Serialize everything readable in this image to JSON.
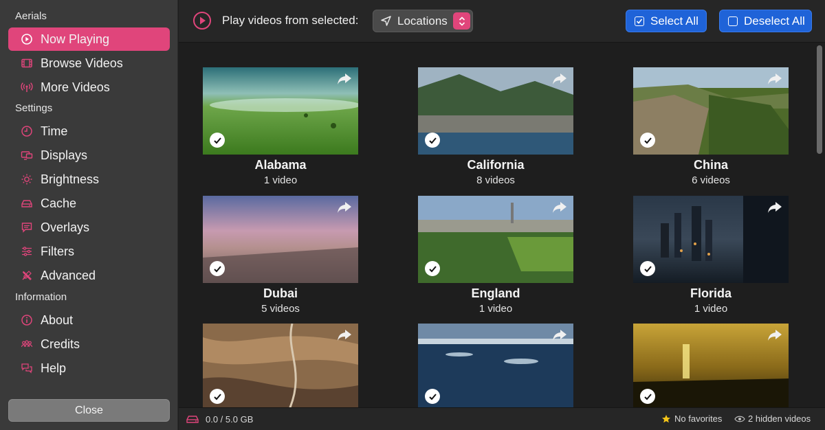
{
  "sidebar": {
    "section_aerials": "Aerials",
    "section_settings": "Settings",
    "section_information": "Information",
    "items": [
      {
        "label": "Now Playing"
      },
      {
        "label": "Browse Videos"
      },
      {
        "label": "More Videos"
      },
      {
        "label": "Time"
      },
      {
        "label": "Displays"
      },
      {
        "label": "Brightness"
      },
      {
        "label": "Cache"
      },
      {
        "label": "Overlays"
      },
      {
        "label": "Filters"
      },
      {
        "label": "Advanced"
      },
      {
        "label": "About"
      },
      {
        "label": "Credits"
      },
      {
        "label": "Help"
      }
    ],
    "close_label": "Close",
    "accent": "#e0457b"
  },
  "toolbar": {
    "play_label": "Play videos from selected:",
    "source_value": "Locations",
    "select_all_label": "Select All",
    "deselect_all_label": "Deselect All"
  },
  "locations": [
    {
      "name": "Alabama",
      "count": "1 video",
      "selected": true
    },
    {
      "name": "California",
      "count": "8 videos",
      "selected": true
    },
    {
      "name": "China",
      "count": "6 videos",
      "selected": true
    },
    {
      "name": "Dubai",
      "count": "5 videos",
      "selected": true
    },
    {
      "name": "England",
      "count": "1 video",
      "selected": true
    },
    {
      "name": "Florida",
      "count": "1 video",
      "selected": true
    },
    {
      "name": "",
      "count": "",
      "selected": true
    },
    {
      "name": "",
      "count": "",
      "selected": true
    },
    {
      "name": "",
      "count": "",
      "selected": true
    }
  ],
  "status": {
    "storage": "0.0 / 5.0 GB",
    "favorites": "No favorites",
    "hidden": "2 hidden videos"
  }
}
